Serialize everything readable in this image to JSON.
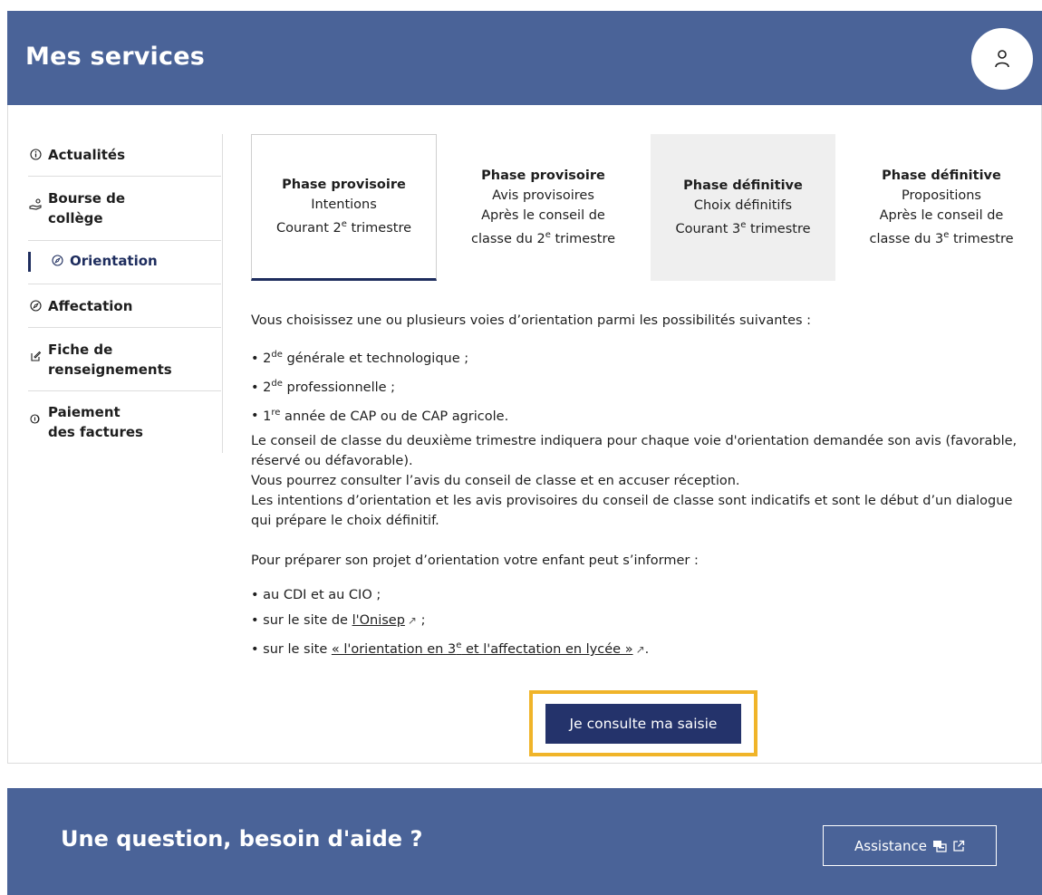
{
  "header": {
    "title": "Mes services",
    "user_icon": "user-icon"
  },
  "sidebar": {
    "items": [
      {
        "icon": "info-icon",
        "label": "Actualités"
      },
      {
        "icon": "hand-coins-icon",
        "label": "Bourse de collège"
      },
      {
        "icon": "compass-icon",
        "label": "Orientation",
        "active": true
      },
      {
        "icon": "compass-icon",
        "label": "Affectation"
      },
      {
        "icon": "edit-icon",
        "label": "Fiche de renseignements"
      },
      {
        "icon": "coins-icon",
        "label": "Paiement des factures"
      }
    ]
  },
  "tabs": [
    {
      "title": "Phase provisoire",
      "line1": "Intentions",
      "line2": "Courant 2",
      "sup": "e",
      "line2b": " trimestre",
      "selected": true
    },
    {
      "title": "Phase provisoire",
      "line1": "Avis provisoires",
      "line2": "Après le conseil de classe du 2",
      "sup": "e",
      "line2b": " trimestre"
    },
    {
      "title": "Phase définitive",
      "line1": "Choix définitifs",
      "line2": "Courant 3",
      "sup": "e",
      "line2b": " trimestre"
    },
    {
      "title": "Phase définitive",
      "line1": "Propositions",
      "line2": "Après le conseil de classe du 3",
      "sup": "e",
      "line2b": " trimestre"
    }
  ],
  "content": {
    "intro": "Vous choisissez une ou plusieurs voies d’orientation parmi les possibilités suivantes :",
    "voies": [
      {
        "pre": "2",
        "sup": "de",
        "text": " générale et technologique ;"
      },
      {
        "pre": "2",
        "sup": "de",
        "text": " professionnelle ;"
      },
      {
        "pre": "1",
        "sup": "re",
        "text": " année de CAP ou de CAP agricole."
      }
    ],
    "para1": "Le conseil de classe du deuxième trimestre indiquera pour chaque voie d'orientation demandée son avis (favorable, réservé ou défavorable).",
    "para2": "Vous pourrez consulter l’avis du conseil de classe et en accuser réception.",
    "para3": "Les intentions d’orientation et les avis provisoires du conseil de classe sont indicatifs et sont le début d’un dialogue qui prépare le choix définitif.",
    "info_intro": "Pour préparer son projet d’orientation votre enfant peut s’informer :",
    "info1": "au CDI et au CIO ;",
    "info2_pre": "sur le site de ",
    "info2_link": "l'Onisep",
    "info2_post": " ;",
    "info3_pre": "sur le site ",
    "info3_link_a": "« l'orientation en 3",
    "info3_link_sup": "e",
    "info3_link_b": " et l'affectation en lycée »",
    "info3_post": "."
  },
  "cta": {
    "label": "Je consulte ma saisie"
  },
  "footer": {
    "question": "Une question, besoin d'aide ?",
    "assistance_label": "Assistance"
  },
  "colors": {
    "primary": "#4a6398",
    "dark_blue": "#24336b",
    "highlight": "#f0b429"
  }
}
